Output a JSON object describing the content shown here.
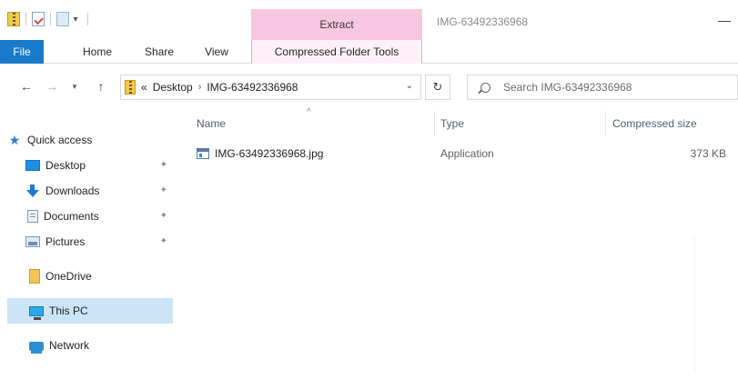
{
  "titlebar": {
    "extract_tab": "Extract",
    "window_title": "IMG-63492336968",
    "minimize_glyph": "—",
    "qat_dropdown_glyph": "▾"
  },
  "ribbon": {
    "tabs": [
      {
        "label": "File"
      },
      {
        "label": "Home"
      },
      {
        "label": "Share"
      },
      {
        "label": "View"
      },
      {
        "label": "Compressed Folder Tools"
      }
    ]
  },
  "navigation": {
    "back_glyph": "←",
    "forward_glyph": "→",
    "recent_glyph": "▾",
    "up_glyph": "↑",
    "refresh_glyph": "↻"
  },
  "addressbar": {
    "overflow_glyph": "«",
    "segments": [
      "Desktop",
      "IMG-63492336968"
    ],
    "separator_glyph": "›",
    "dropdown_glyph": "⌄"
  },
  "search": {
    "placeholder": "Search IMG-63492336968"
  },
  "sidebar": {
    "items": [
      {
        "label": "Quick access",
        "icon": "star-icon"
      },
      {
        "label": "Desktop",
        "icon": "desktop-icon",
        "pinned": true
      },
      {
        "label": "Downloads",
        "icon": "downloads-icon",
        "pinned": true
      },
      {
        "label": "Documents",
        "icon": "documents-icon",
        "pinned": true
      },
      {
        "label": "Pictures",
        "icon": "pictures-icon",
        "pinned": true
      },
      {
        "label": "OneDrive",
        "icon": "onedrive-icon"
      },
      {
        "label": "This PC",
        "icon": "this-pc-icon",
        "selected": true
      },
      {
        "label": "Network",
        "icon": "network-icon"
      }
    ],
    "pin_glyph": "✦",
    "star_glyph": "★"
  },
  "filelist": {
    "sort_glyph": "^",
    "columns": {
      "name": "Name",
      "type": "Type",
      "size": "Compressed size"
    },
    "rows": [
      {
        "name": "IMG-63492336968.jpg",
        "type": "Application",
        "size": "373 KB"
      }
    ]
  },
  "colors": {
    "file_tab": "#1979ca",
    "context_tab": "#f7c6e0",
    "selection": "#cce4f7",
    "header_text": "#4c607a"
  }
}
